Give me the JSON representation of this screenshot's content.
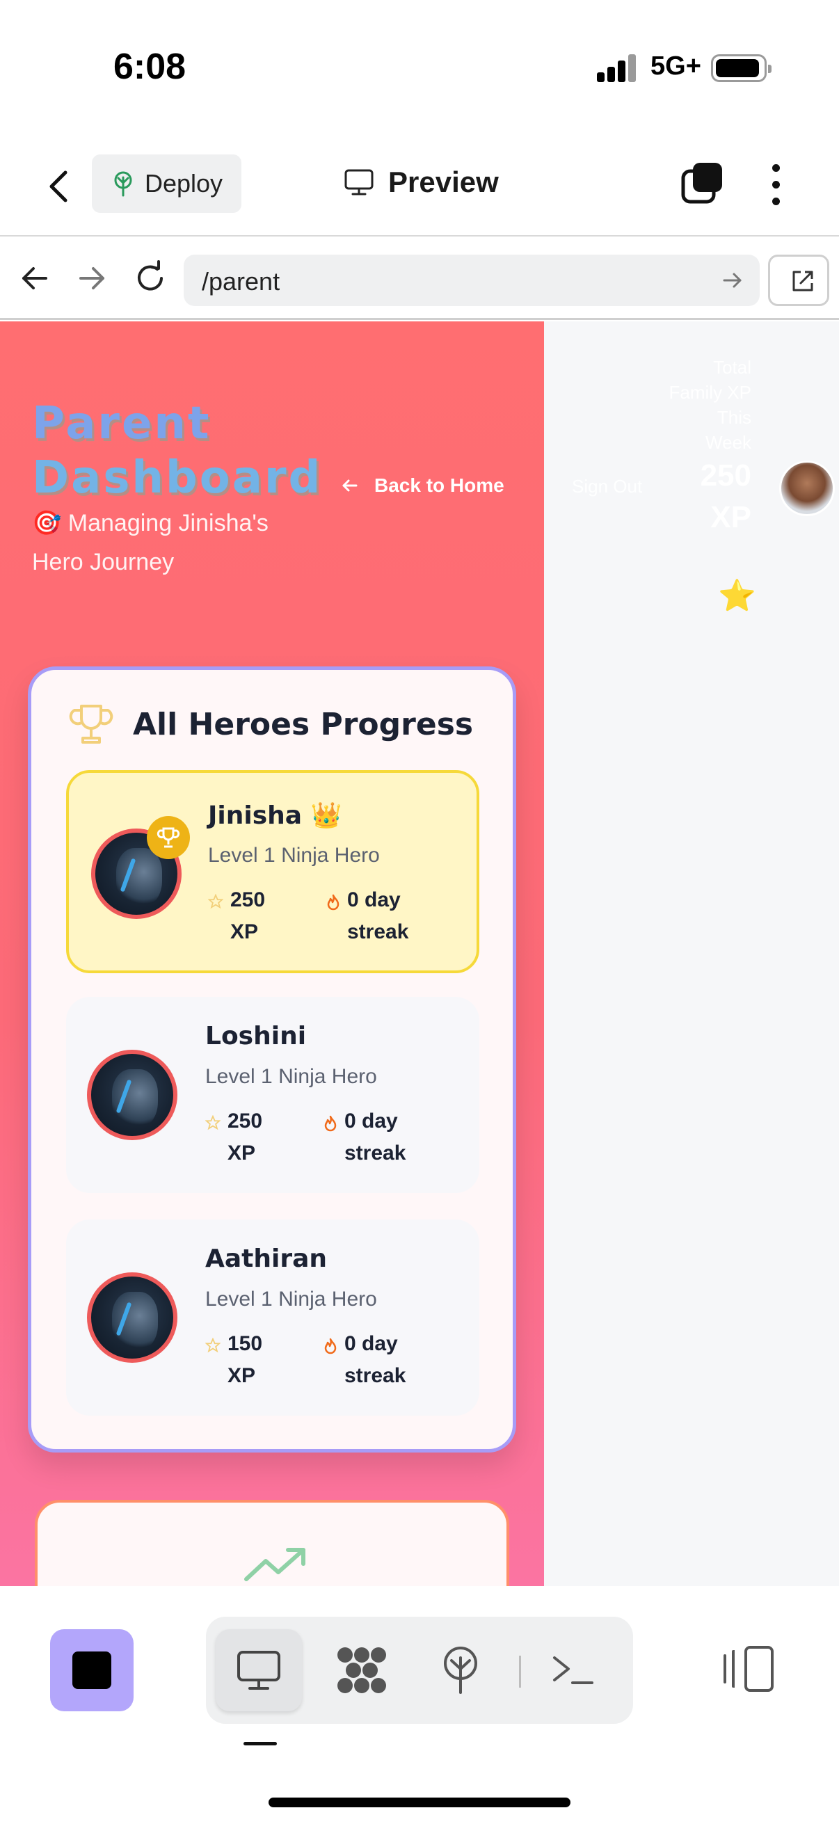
{
  "status_bar": {
    "time": "6:08",
    "network": "5G+"
  },
  "toolbar": {
    "deploy_label": "Deploy",
    "preview_label": "Preview"
  },
  "url_bar": {
    "url": "/parent"
  },
  "dashboard": {
    "title_line1": "Parent",
    "title_line2": "Dashboard",
    "subtitle": "🎯 Managing Jinisha's Hero Journey",
    "back_home": "Back to Home",
    "sign_out": "Sign Out",
    "family_xp_label": "Total Family XP This Week",
    "family_xp_value": "250 XP",
    "star": "⭐"
  },
  "heroes_card": {
    "title": "All Heroes Progress",
    "heroes": [
      {
        "name": "Jinisha 👑",
        "level": "Level 1 Ninja Hero",
        "xp": "250 XP",
        "streak": "0 day streak",
        "active": true
      },
      {
        "name": "Loshini",
        "level": "Level 1 Ninja Hero",
        "xp": "250 XP",
        "streak": "0 day streak",
        "active": false
      },
      {
        "name": "Aathiran",
        "level": "Level 1 Ninja Hero",
        "xp": "150 XP",
        "streak": "0 day streak",
        "active": false
      }
    ]
  },
  "colors": {
    "accent": "#b3a6fb",
    "card_border": "#a79cf7",
    "active_hero_bg": "#fff6c6",
    "active_hero_border": "#f6d93a",
    "gradient_top": "#ff6e71",
    "gradient_bottom": "#fb74a2"
  },
  "icons": [
    "back-icon",
    "deploy-tree-icon",
    "monitor-icon",
    "tabs-icon",
    "more-icon",
    "arrow-left-icon",
    "arrow-right-icon",
    "reload-icon",
    "go-arrow-icon",
    "external-link-icon",
    "trophy-icon",
    "star-icon",
    "flame-icon",
    "trend-up-icon",
    "stop-icon",
    "workflow-icon",
    "deploy-icon",
    "terminal-icon",
    "panel-icon"
  ]
}
